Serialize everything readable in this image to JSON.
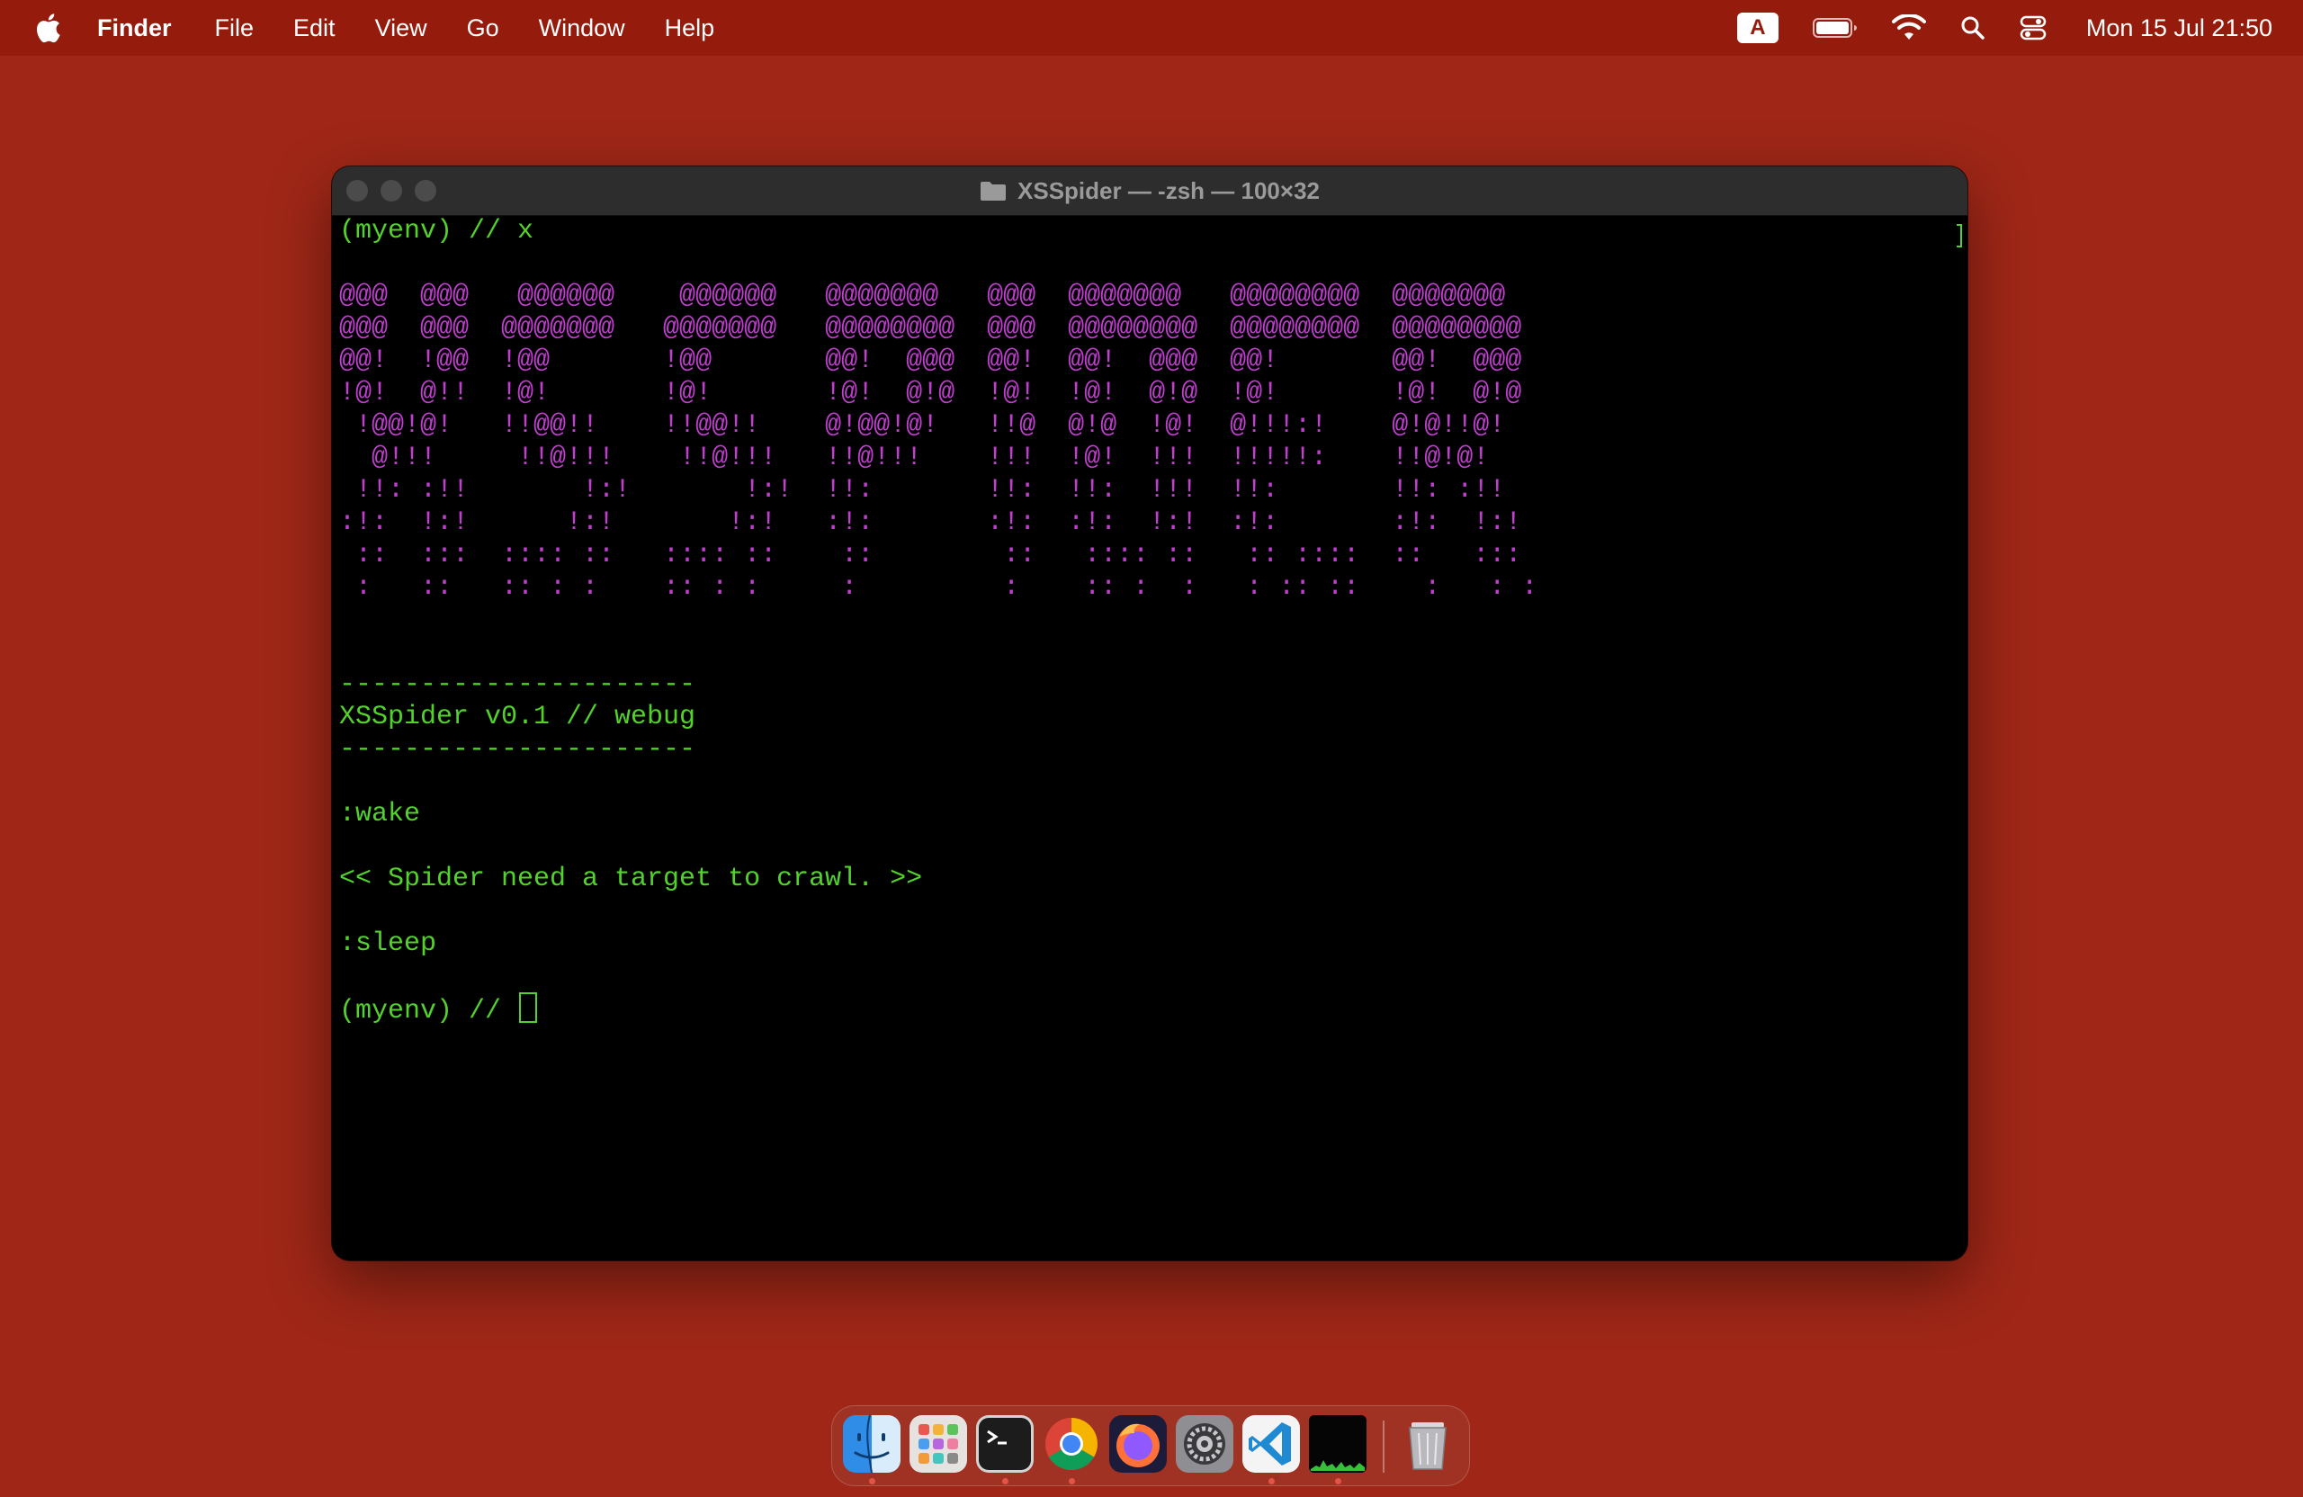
{
  "menubar": {
    "app_name": "Finder",
    "items": [
      "File",
      "Edit",
      "View",
      "Go",
      "Window",
      "Help"
    ],
    "input_source": "A",
    "clock": "Mon 15 Jul  21:50"
  },
  "window": {
    "title": "XSSpider — -zsh — 100×32"
  },
  "terminal": {
    "first_prompt": "(myenv) // x",
    "banner": [
      "@@@  @@@   @@@@@@    @@@@@@   @@@@@@@   @@@  @@@@@@@   @@@@@@@@  @@@@@@@",
      "@@@  @@@  @@@@@@@   @@@@@@@   @@@@@@@@  @@@  @@@@@@@@  @@@@@@@@  @@@@@@@@",
      "@@!  !@@  !@@       !@@       @@!  @@@  @@!  @@!  @@@  @@!       @@!  @@@",
      "!@!  @!!  !@!       !@!       !@!  @!@  !@!  !@!  @!@  !@!       !@!  @!@",
      " !@@!@!   !!@@!!    !!@@!!    @!@@!@!   !!@  @!@  !@!  @!!!:!    @!@!!@!",
      "  @!!!     !!@!!!    !!@!!!   !!@!!!    !!!  !@!  !!!  !!!!!:    !!@!@!",
      " !!: :!!       !:!       !:!  !!:       !!:  !!:  !!!  !!:       !!: :!!",
      ":!:  !:!      !:!       !:!   :!:       :!:  :!:  !:!  :!:       :!:  !:!",
      " ::  :::  :::: ::   :::: ::    ::        ::   :::: ::   :: ::::  ::   :::",
      " :   ::   :: : :    :: : :     :         :    :: :  :   : :: ::    :   : :"
    ],
    "separator": "----------------------",
    "version": "XSSpider v0.1 // webug",
    "wake": ":wake",
    "message": "<< Spider need a target to crawl. >>",
    "sleep": ":sleep",
    "prompt": "(myenv) // "
  },
  "dock": {
    "apps": [
      "finder-icon",
      "launchpad-icon",
      "terminal-icon",
      "chrome-icon",
      "firefox-icon",
      "system-settings-icon",
      "vscode-icon",
      "activity-monitor-icon"
    ],
    "trash": "trash-icon"
  }
}
